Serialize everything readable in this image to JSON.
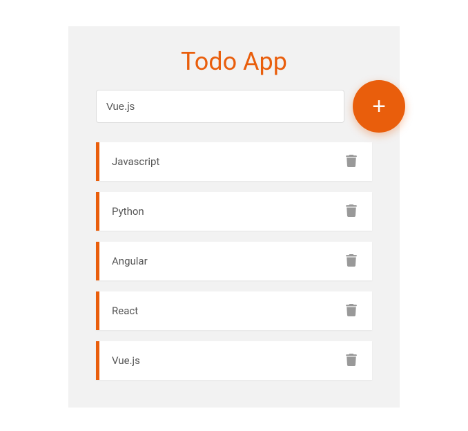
{
  "title": "Todo App",
  "input": {
    "value": "Vue.js"
  },
  "colors": {
    "accent": "#e95e0c"
  },
  "todos": [
    {
      "label": "Javascript"
    },
    {
      "label": "Python"
    },
    {
      "label": "Angular"
    },
    {
      "label": "React"
    },
    {
      "label": "Vue.js"
    }
  ]
}
